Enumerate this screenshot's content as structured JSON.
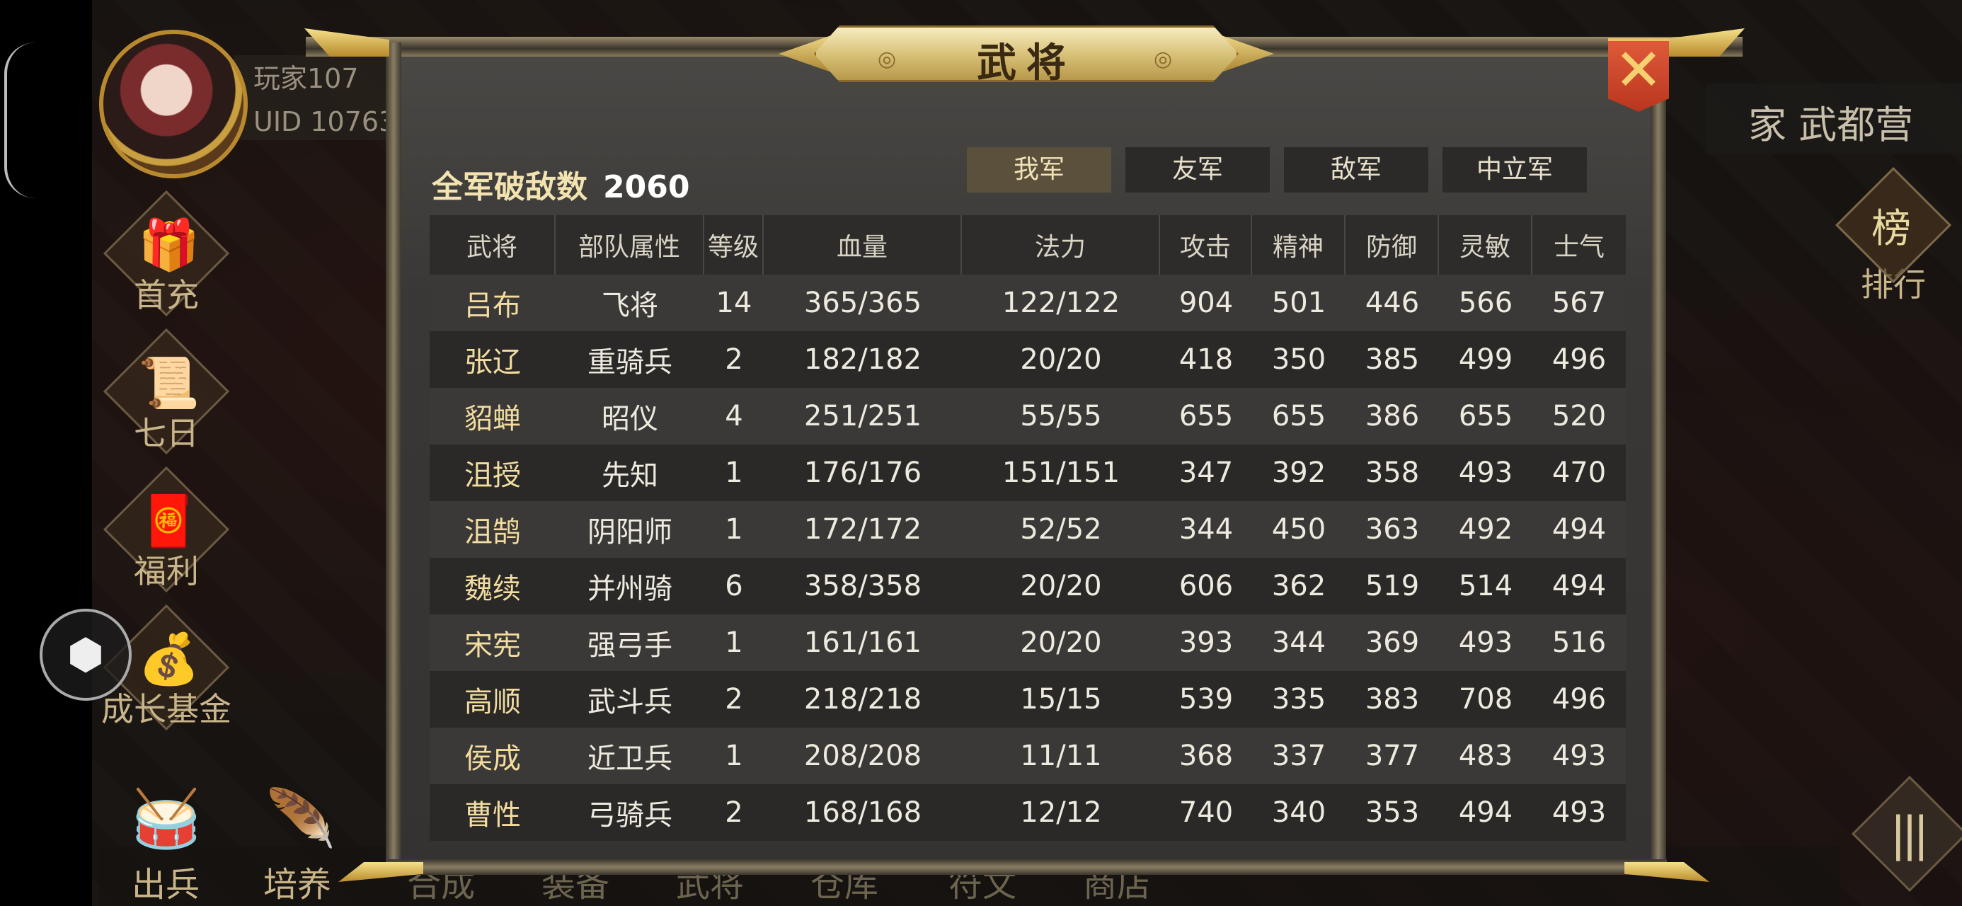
{
  "player": {
    "name": "玩家107",
    "uid": "UID  10763"
  },
  "side_menu": [
    {
      "label": "首充",
      "icon": "gift-chest-icon"
    },
    {
      "label": "七日",
      "icon": "scroll-icon"
    },
    {
      "label": "福利",
      "icon": "gift-box-icon"
    },
    {
      "label": "成长基金",
      "icon": "gold-coins-icon"
    }
  ],
  "right_panel": {
    "camp": "家 武都营",
    "rank_label": "排行",
    "rank_icon_text": "榜"
  },
  "bottom_nav": [
    {
      "label": "出兵",
      "icon": "drum-icon"
    },
    {
      "label": "培养",
      "icon": "feather-icon"
    },
    {
      "label": "合成"
    },
    {
      "label": "装备"
    },
    {
      "label": "武将"
    },
    {
      "label": "仓库"
    },
    {
      "label": "符文"
    },
    {
      "label": "商店"
    }
  ],
  "dialog": {
    "title": "武将",
    "kills_label": "全军破敌数",
    "kills_value": "2060",
    "tabs": [
      {
        "label": "我军",
        "active": true
      },
      {
        "label": "友军",
        "active": false
      },
      {
        "label": "敌军",
        "active": false
      },
      {
        "label": "中立军",
        "active": false
      }
    ],
    "columns": [
      "武将",
      "部队属性",
      "等级",
      "血量",
      "法力",
      "攻击",
      "精神",
      "防御",
      "灵敏",
      "士气"
    ],
    "rows": [
      [
        "吕布",
        "飞将",
        "14",
        "365/365",
        "122/122",
        "904",
        "501",
        "446",
        "566",
        "567"
      ],
      [
        "张辽",
        "重骑兵",
        "2",
        "182/182",
        "20/20",
        "418",
        "350",
        "385",
        "499",
        "496"
      ],
      [
        "貂蝉",
        "昭仪",
        "4",
        "251/251",
        "55/55",
        "655",
        "655",
        "386",
        "655",
        "520"
      ],
      [
        "沮授",
        "先知",
        "1",
        "176/176",
        "151/151",
        "347",
        "392",
        "358",
        "493",
        "470"
      ],
      [
        "沮鹄",
        "阴阳师",
        "1",
        "172/172",
        "52/52",
        "344",
        "450",
        "363",
        "492",
        "494"
      ],
      [
        "魏续",
        "并州骑",
        "6",
        "358/358",
        "20/20",
        "606",
        "362",
        "519",
        "514",
        "494"
      ],
      [
        "宋宪",
        "强弓手",
        "1",
        "161/161",
        "20/20",
        "393",
        "344",
        "369",
        "493",
        "516"
      ],
      [
        "高顺",
        "武斗兵",
        "2",
        "218/218",
        "15/15",
        "539",
        "335",
        "383",
        "708",
        "496"
      ],
      [
        "侯成",
        "近卫兵",
        "1",
        "208/208",
        "11/11",
        "368",
        "337",
        "377",
        "483",
        "493"
      ],
      [
        "曹性",
        "弓骑兵",
        "2",
        "168/168",
        "12/12",
        "740",
        "340",
        "353",
        "494",
        "493"
      ]
    ]
  }
}
